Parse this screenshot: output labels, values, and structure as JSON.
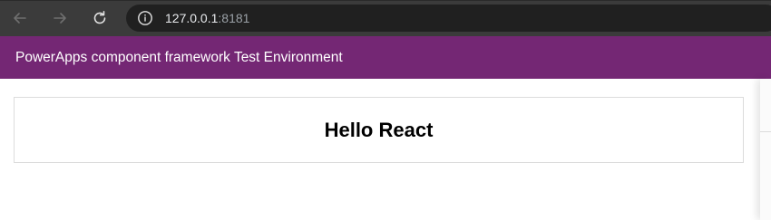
{
  "browser": {
    "url_host": "127.0.0.1",
    "url_port": ":8181"
  },
  "app": {
    "title": "PowerApps component framework Test Environment"
  },
  "control": {
    "heading": "Hello React"
  },
  "colors": {
    "browser_toolbar": "#3b3b3b",
    "omnibox": "#202020",
    "header_bg": "#742774",
    "header_text": "#ffffff"
  }
}
